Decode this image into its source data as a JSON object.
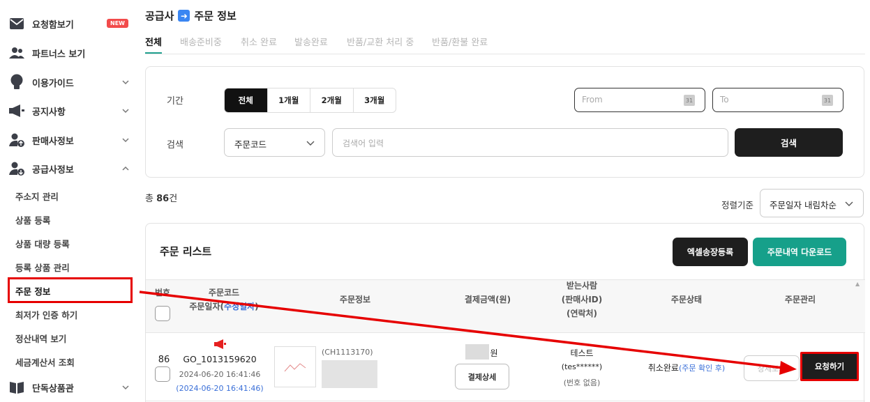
{
  "sidebar": {
    "items": [
      {
        "label": "요청함보기",
        "icon": "mail-icon",
        "badge": "NEW"
      },
      {
        "label": "파트너스 보기",
        "icon": "people-icon"
      },
      {
        "label": "이용가이드",
        "icon": "lightbulb-icon"
      },
      {
        "label": "공지사항",
        "icon": "megaphone-icon"
      },
      {
        "label": "판매사정보",
        "icon": "user-upload-icon"
      },
      {
        "label": "공급사정보",
        "icon": "user-download-icon"
      }
    ],
    "sub_items": [
      "주소지 관리",
      "상품 등록",
      "상품 대량 등록",
      "등록 상품 관리",
      "주문 정보",
      "최저가 인증 하기",
      "정산내역 보기",
      "세금계산서 조회"
    ],
    "last_item": {
      "label": "단독상품관",
      "icon": "book-icon"
    }
  },
  "breadcrumb": {
    "left": "공급사",
    "right": "주문 정보"
  },
  "tabs": [
    "전체",
    "배송준비중",
    "취소 완료",
    "발송완료",
    "반품/교환 처리 중",
    "반품/환불 완료"
  ],
  "filter": {
    "period_label": "기간",
    "period_buttons": [
      "전체",
      "1개월",
      "2개월",
      "3개월"
    ],
    "from_placeholder": "From",
    "to_placeholder": "To",
    "calendar_day": "31",
    "search_label": "검색",
    "search_type": "주문코드",
    "search_placeholder": "검색어 입력",
    "search_button": "검색"
  },
  "summary": {
    "prefix": "총 ",
    "count": "86",
    "suffix": "건"
  },
  "sort": {
    "label": "정렬기준",
    "value": "주문일자 내림차순"
  },
  "list": {
    "title": "주문 리스트",
    "excel_button": "엑셀송장등록",
    "download_button": "주문내역 다운로드",
    "headers": {
      "no": "번호",
      "code_line1": "주문코드",
      "code_line2a": "주문일자(",
      "code_line2b": "수정일자",
      "code_line2c": ")",
      "info": "주문정보",
      "amount": "결제금액(원)",
      "recv_line1": "받는사람",
      "recv_line2": "(판매사ID)",
      "recv_line3": "(연락처)",
      "status": "주문상태",
      "manage": "주문관리"
    },
    "row": {
      "no": "86",
      "code": "GO_1013159620",
      "date": "2024-06-20 16:41:46",
      "updated": "(2024-06-20 16:41:46)",
      "product_code": "(CH1113170)",
      "currency": "원",
      "pay_button": "결제상세",
      "receiver": "테스트",
      "seller_id": "(tes******)",
      "phone": "(번호 없음)",
      "status": "취소완료",
      "status_note": "(주문 확인 후)",
      "ghost_button": "상세보기",
      "request_button": "요청하기"
    }
  },
  "colors": {
    "accent_green": "#16a08a",
    "highlight_red": "#e60000",
    "link_blue": "#3a6fd8"
  }
}
